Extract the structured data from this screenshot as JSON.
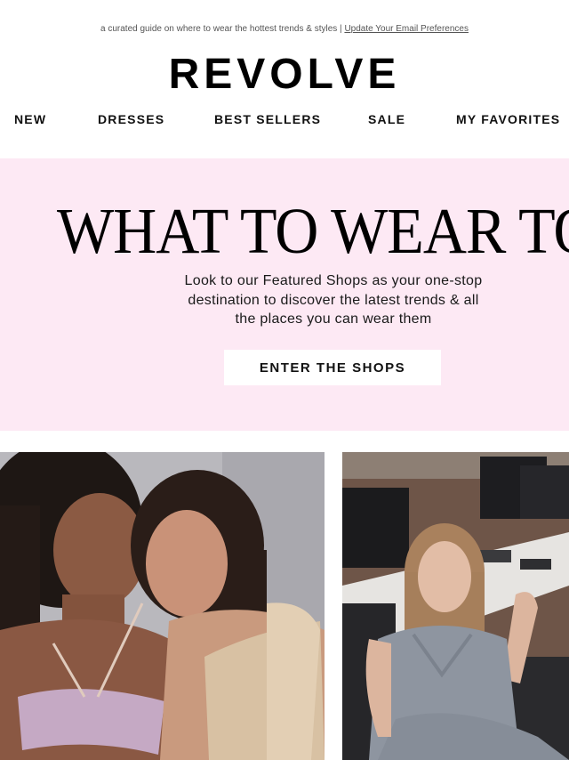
{
  "preheader": {
    "text": "a curated guide on where to wear the hottest trends & styles |",
    "link": "Update Your Email Preferences"
  },
  "logo": "REVOLVE",
  "nav": [
    "NEW",
    "DRESSES",
    "BEST SELLERS",
    "SALE",
    "MY FAVORITES"
  ],
  "hero": {
    "title": "WHAT TO WEAR TO",
    "copy_lines": [
      "Look to our Featured Shops as your one-stop",
      "destination to discover the latest trends & all",
      "the places you can wear them"
    ],
    "button": "ENTER THE SHOPS",
    "background": "#fde9f4"
  },
  "images": [
    {
      "name": "two models in sequin tops"
    },
    {
      "name": "model in grey vest in office"
    }
  ]
}
